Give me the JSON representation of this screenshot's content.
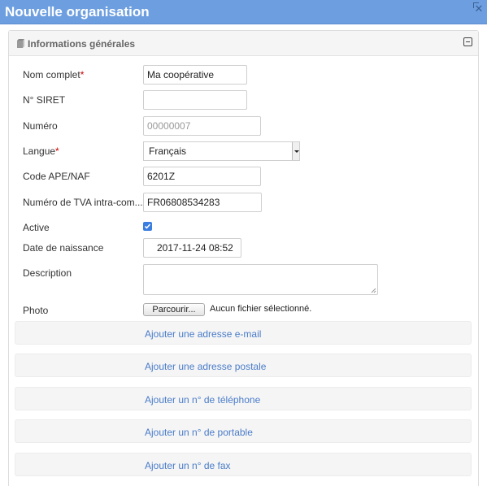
{
  "window": {
    "title": "Nouvelle organisation",
    "close_icon": "close-icon"
  },
  "panel": {
    "title": "Informations générales",
    "icon": "book-icon",
    "collapse_icon": "minus-square-icon"
  },
  "form": {
    "nom_complet": {
      "label": "Nom complet",
      "required_mark": "*",
      "value": "Ma coopérative"
    },
    "siret": {
      "label": "N° SIRET",
      "value": ""
    },
    "numero": {
      "label": "Numéro",
      "value": "00000007"
    },
    "langue": {
      "label": "Langue",
      "required_mark": "*",
      "value": "Français"
    },
    "ape": {
      "label": "Code APE/NAF",
      "value": "6201Z"
    },
    "tva": {
      "label": "Numéro de TVA intra-com...",
      "value": "FR06808534283"
    },
    "active": {
      "label": "Active",
      "checked": true
    },
    "date": {
      "label": "Date de naissance",
      "value": "2017-11-24 08:52"
    },
    "description": {
      "label": "Description",
      "value": ""
    },
    "photo": {
      "label": "Photo",
      "button": "Parcourir...",
      "status": "Aucun fichier sélectionné."
    }
  },
  "add_links": [
    {
      "label": "Ajouter une adresse e-mail"
    },
    {
      "label": "Ajouter une adresse postale"
    },
    {
      "label": "Ajouter un n° de téléphone"
    },
    {
      "label": "Ajouter un n° de portable"
    },
    {
      "label": "Ajouter un n° de fax"
    }
  ],
  "colors": {
    "titlebar": "#6d9fe0",
    "link": "#4a7cc9",
    "required": "#cc0000",
    "checkbox": "#3a7ee0"
  }
}
